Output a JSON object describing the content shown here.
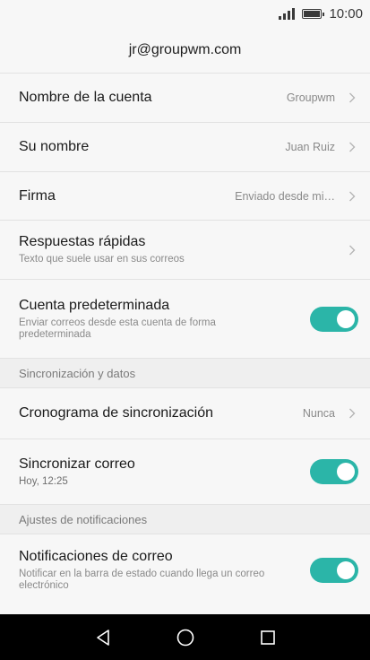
{
  "status": {
    "time": "10:00"
  },
  "header": {
    "title": "jr@groupwm.com"
  },
  "rows": [
    {
      "title": "Nombre de la cuenta",
      "value": "Groupwm"
    },
    {
      "title": "Su nombre",
      "value": "Juan Ruiz"
    },
    {
      "title": "Firma",
      "value": "Enviado desde mi…"
    },
    {
      "title": "Respuestas rápidas",
      "sub": "Texto que suele usar en sus correos"
    },
    {
      "title": "Cuenta predeterminada",
      "sub": "Enviar correos desde esta cuenta de forma predeterminada",
      "toggle": true
    }
  ],
  "section_sync": "Sincronización y datos",
  "sync_rows": [
    {
      "title": "Cronograma de sincronización",
      "value": "Nunca"
    },
    {
      "title": "Sincronizar correo",
      "sub": "Hoy, 12:25",
      "toggle": true
    }
  ],
  "section_notif": "Ajustes de notificaciones",
  "notif_rows": [
    {
      "title": "Notificaciones de correo",
      "sub": "Notificar en la barra de estado cuando llega un correo electrónico",
      "toggle": true
    }
  ],
  "colors": {
    "accent": "#2bb5a8",
    "nav_bg": "#000000"
  },
  "nav": {
    "icons": [
      "back-icon",
      "home-icon",
      "recents-icon"
    ]
  }
}
